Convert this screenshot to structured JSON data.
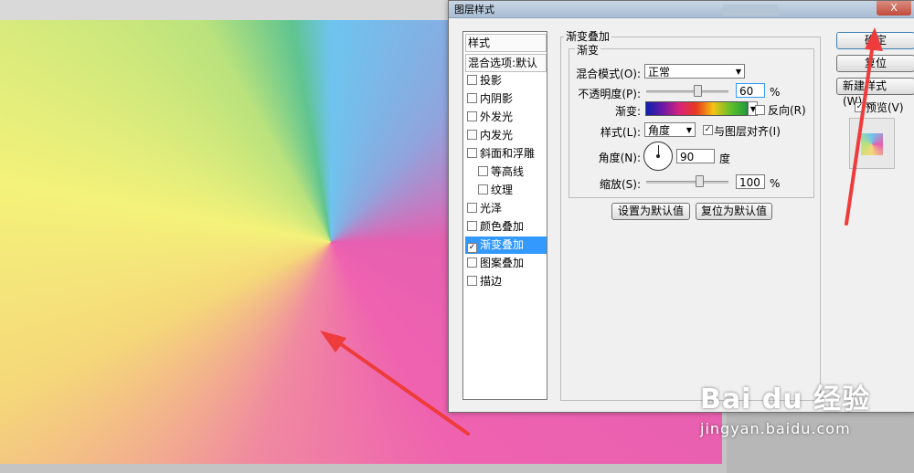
{
  "dialog": {
    "title": "图层样式",
    "close_label": "X"
  },
  "style_list": {
    "header": "样式",
    "blend_defaults": "混合选项:默认",
    "items": [
      {
        "label": "投影",
        "checked": false
      },
      {
        "label": "内阴影",
        "checked": false
      },
      {
        "label": "外发光",
        "checked": false
      },
      {
        "label": "内发光",
        "checked": false
      },
      {
        "label": "斜面和浮雕",
        "checked": false
      },
      {
        "label": "等高线",
        "checked": false
      },
      {
        "label": "纹理",
        "checked": false
      },
      {
        "label": "光泽",
        "checked": false
      },
      {
        "label": "颜色叠加",
        "checked": false
      },
      {
        "label": "渐变叠加",
        "checked": true,
        "selected": true
      },
      {
        "label": "图案叠加",
        "checked": false
      },
      {
        "label": "描边",
        "checked": false
      }
    ]
  },
  "panel": {
    "section_title": "渐变叠加",
    "group_title": "渐变",
    "blend_mode_label": "混合模式(O):",
    "blend_mode_value": "正常",
    "opacity_label": "不透明度(P):",
    "opacity_value": "60",
    "opacity_unit": "%",
    "gradient_label": "渐变:",
    "reverse_label": "反向(R)",
    "reverse_checked": false,
    "style_label": "样式(L):",
    "style_value": "角度",
    "align_label": "与图层对齐(I)",
    "align_checked": true,
    "angle_label": "角度(N):",
    "angle_value": "90",
    "angle_unit": "度",
    "scale_label": "缩放(S):",
    "scale_value": "100",
    "scale_unit": "%",
    "set_default_button": "设置为默认值",
    "reset_default_button": "复位为默认值"
  },
  "actions": {
    "ok_button": "确定",
    "reset_button": "复位",
    "new_style_button": "新建样式(W)...",
    "preview_label": "预览(V)",
    "preview_checked": true
  },
  "watermark": {
    "brand": "Bai du 经验",
    "url": "jingyan.baidu.com"
  },
  "colors": {
    "selected": "#3399ff",
    "annotation_arrow": "#ee3b3b"
  }
}
